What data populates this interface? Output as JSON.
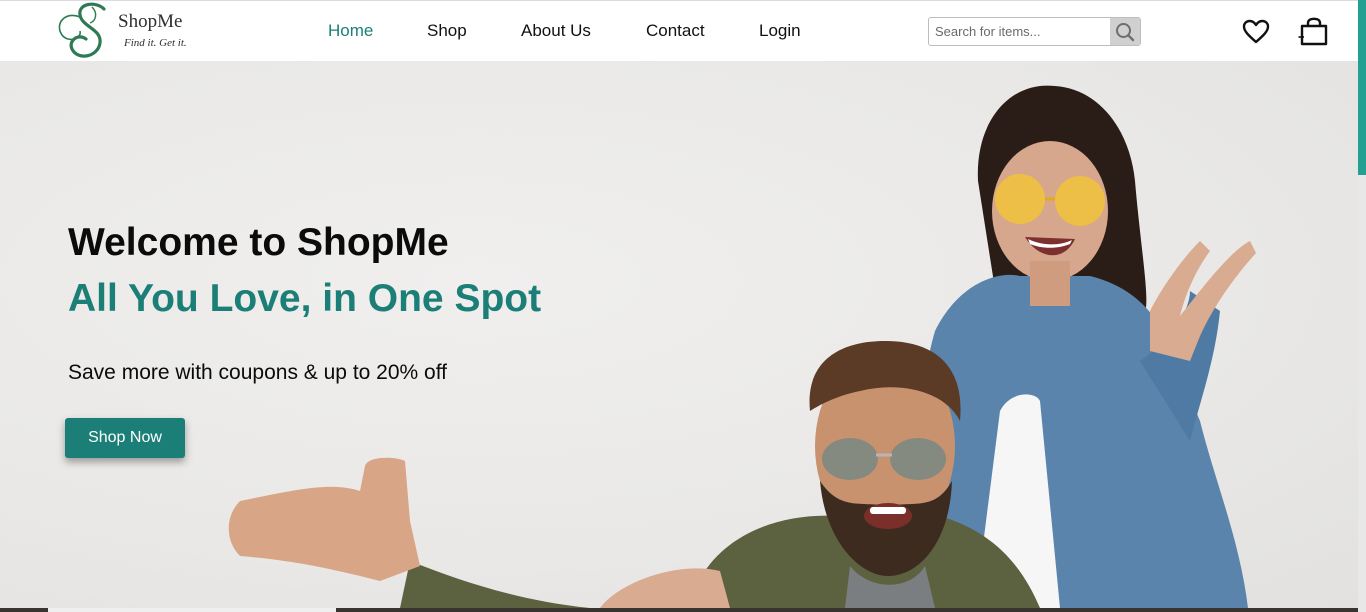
{
  "brand": {
    "name": "ShopMe",
    "tagline": "Find it. Get it."
  },
  "nav": {
    "items": [
      {
        "label": "Home",
        "active": true
      },
      {
        "label": "Shop",
        "active": false
      },
      {
        "label": "About Us",
        "active": false
      },
      {
        "label": "Contact",
        "active": false
      },
      {
        "label": "Login",
        "active": false
      }
    ]
  },
  "search": {
    "placeholder": "Search for items...",
    "value": ""
  },
  "icons": {
    "search": "search-icon",
    "wishlist": "heart-icon",
    "cart": "shopping-bag-icon"
  },
  "hero": {
    "title": "Welcome to ShopMe",
    "subtitle": "All You Love, in One Spot",
    "text": "Save more with coupons & up to 20% off",
    "cta_label": "Shop Now"
  },
  "colors": {
    "accent": "#1b7f78",
    "scrollbar": "#24a093",
    "text": "#0b0b0b",
    "hero_bg": "#ebeae8"
  }
}
